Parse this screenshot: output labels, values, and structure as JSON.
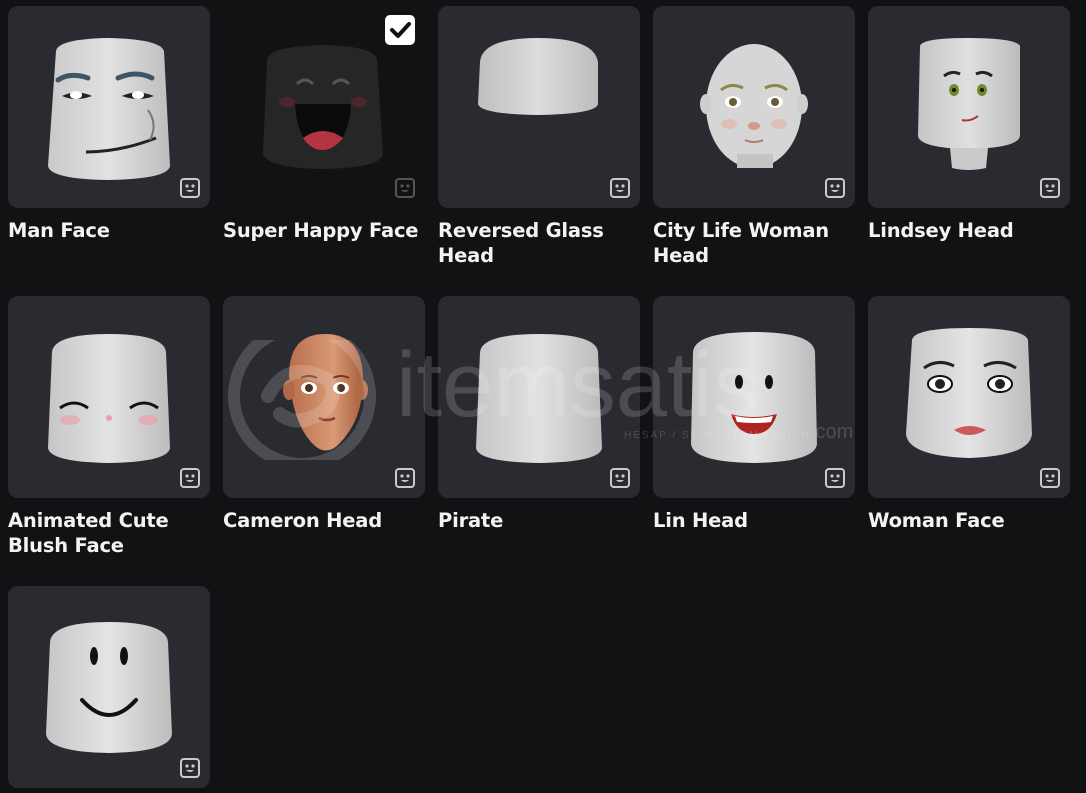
{
  "items": [
    {
      "name": "Man Face",
      "selected": false
    },
    {
      "name": "Super Happy Face",
      "selected": true
    },
    {
      "name": "Reversed Glass Head",
      "selected": false
    },
    {
      "name": "City Life Woman Head",
      "selected": false
    },
    {
      "name": "Lindsey Head",
      "selected": false
    },
    {
      "name": "Animated Cute Blush Face",
      "selected": false
    },
    {
      "name": "Cameron Head",
      "selected": false
    },
    {
      "name": "Pirate",
      "selected": false
    },
    {
      "name": "Lin Head",
      "selected": false
    },
    {
      "name": "Woman Face",
      "selected": false
    },
    {
      "name": "",
      "selected": false
    }
  ],
  "watermark": {
    "brand": "itemsatis",
    "tagline": "HESAP / SKIN / ITEM / E-PIN",
    "suffix": ".com"
  },
  "colors": {
    "background": "#111214",
    "tile": "#2a2b31",
    "text": "#f2f3f5",
    "badge": "#c9cacc"
  },
  "icons": {
    "badge": "face-badge-icon",
    "selected": "checkmark-icon"
  }
}
